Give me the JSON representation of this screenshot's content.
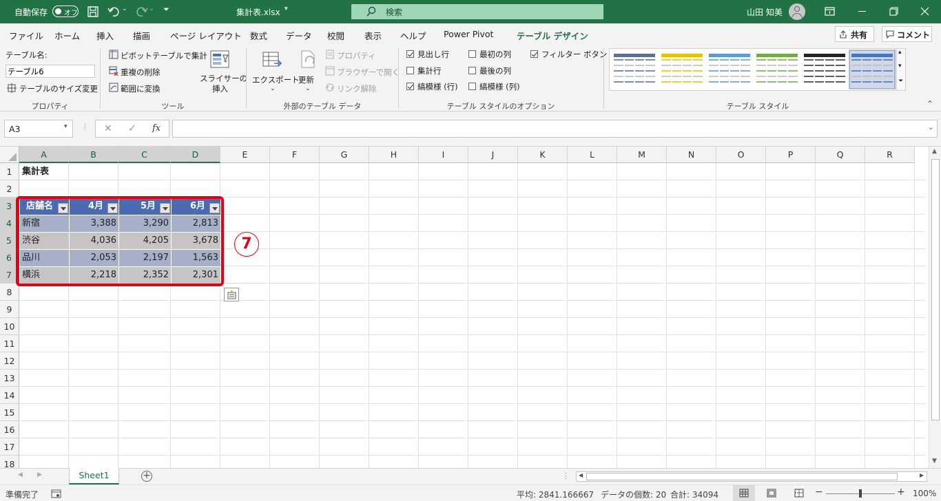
{
  "titlebar": {
    "autosave_label": "自動保存",
    "autosave_state": "オフ",
    "filename": "集計表.xlsx",
    "search_label": "検索",
    "user_name": "山田 知美"
  },
  "menu": {
    "items": [
      "ファイル",
      "ホーム",
      "挿入",
      "描画",
      "ページ レイアウト",
      "数式",
      "データ",
      "校閲",
      "表示",
      "ヘルプ",
      "Power Pivot",
      "テーブル デザイン"
    ],
    "share_label": "共有",
    "comment_label": "コメント"
  },
  "ribbon": {
    "properties": {
      "table_name_label": "テーブル名:",
      "table_name_value": "テーブル6",
      "resize_label": "テーブルのサイズ変更",
      "group_label": "プロパティ"
    },
    "tools": {
      "pivot_label": "ピボットテーブルで集計",
      "remove_dup_label": "重複の削除",
      "convert_label": "範囲に変換",
      "slicer_label_1": "スライサーの",
      "slicer_label_2": "挿入",
      "group_label": "ツール"
    },
    "external": {
      "export_label": "エクスポート",
      "refresh_label": "更新",
      "properties_label": "プロパティ",
      "open_browser_label": "ブラウザーで開く",
      "unlink_label": "リンク解除",
      "group_label": "外部のテーブル データ"
    },
    "style_options": {
      "header_row": "見出し行",
      "total_row": "集計行",
      "banded_rows": "縞模様 (行)",
      "first_col": "最初の列",
      "last_col": "最後の列",
      "banded_cols": "縞模様 (列)",
      "filter_btn": "フィルター ボタン",
      "group_label": "テーブル スタイルのオプション"
    },
    "styles": {
      "group_label": "テーブル スタイル",
      "swatch_colors": [
        "#5b6f99",
        "#e8c200",
        "#5b9bd5",
        "#70ad47",
        "#222222",
        "#4472c4"
      ]
    }
  },
  "formula_bar": {
    "name_box": "A3",
    "fx": "fx",
    "content": ""
  },
  "columns": [
    "A",
    "B",
    "C",
    "D",
    "E",
    "F",
    "G",
    "H",
    "I",
    "J",
    "K",
    "L",
    "M",
    "N",
    "O",
    "P",
    "Q",
    "R"
  ],
  "rows": [
    "1",
    "2",
    "3",
    "4",
    "5",
    "6",
    "7",
    "8",
    "9",
    "10",
    "11",
    "12",
    "13",
    "14",
    "15",
    "16",
    "17",
    "18"
  ],
  "sheet": {
    "title": "集計表",
    "table_headers": [
      "店舗名",
      "4月",
      "5月",
      "6月"
    ],
    "table_rows": [
      [
        "新宿",
        "3,388",
        "3,290",
        "2,813"
      ],
      [
        "渋谷",
        "4,036",
        "4,205",
        "3,678"
      ],
      [
        "品川",
        "2,053",
        "2,197",
        "1,563"
      ],
      [
        "横浜",
        "2,218",
        "2,352",
        "2,301"
      ]
    ],
    "callout_number": "7",
    "callout_color": "#e60012"
  },
  "tabs": {
    "sheet_name": "Sheet1"
  },
  "status": {
    "ready": "準備完了",
    "average": "平均: 2841.166667",
    "count": "データの個数: 20",
    "sum": "合計: 34094",
    "zoom": "100%"
  }
}
